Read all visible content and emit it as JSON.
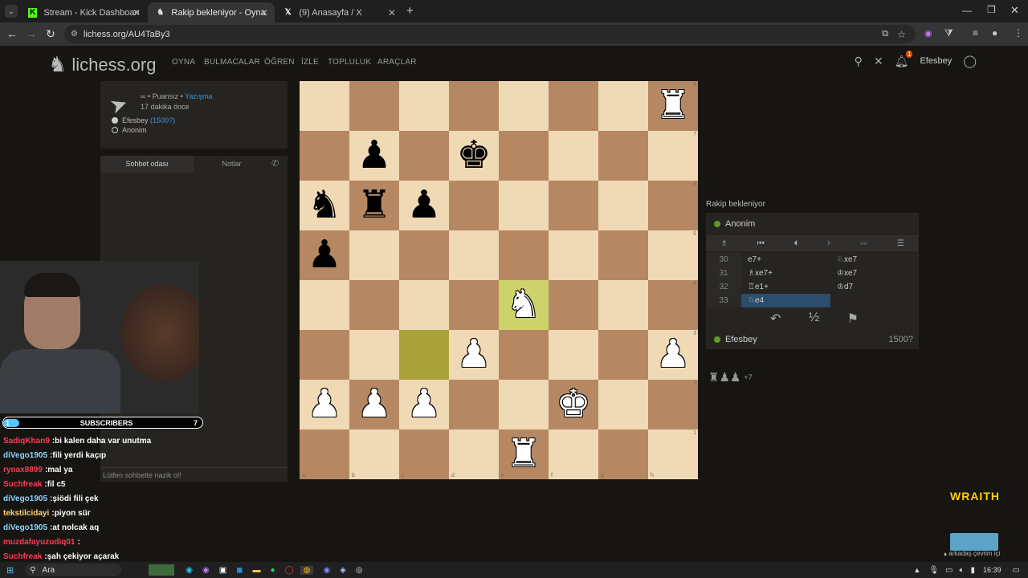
{
  "browser": {
    "tabs": [
      {
        "title": "Stream - Kick Dashboard",
        "icon": "kick-icon"
      },
      {
        "title": "Rakip bekleniyor - Oyna Anon…",
        "icon": "lichess-icon"
      },
      {
        "title": "(9) Anasayfa / X",
        "icon": "x-icon"
      }
    ],
    "url": "lichess.org/AU4TaBy3"
  },
  "site": {
    "logo_text": "lichess.org",
    "nav": [
      "OYNA",
      "BULMACALAR",
      "ÖĞREN",
      "İZLE",
      "TOPLULUK",
      "ARAÇLAR"
    ],
    "username": "Efesbey",
    "notif_count": "1"
  },
  "game_info": {
    "line1_prefix": "∞ • Puansız •",
    "line1_link": "Yazışma",
    "time_ago": "17 dakika önce",
    "player_white": "Efesbey",
    "player_white_rating": "(1500?)",
    "player_black": "Anonim"
  },
  "chat": {
    "tab_room": "Sohbet odası",
    "tab_notes": "Notlar",
    "placeholder": "Lütfen sohbette nazik ol!"
  },
  "board": {
    "rank_labels": [
      "8",
      "7",
      "6",
      "5",
      "4",
      "3",
      "2",
      "1"
    ],
    "file_labels": [
      "a",
      "b",
      "c",
      "d",
      "e",
      "f",
      "g",
      "h"
    ],
    "pieces": [
      {
        "sq": "h8",
        "g": "♜",
        "color": "w",
        "name": "white-rook"
      },
      {
        "sq": "b7",
        "g": "♟",
        "color": "b",
        "name": "black-pawn"
      },
      {
        "sq": "d7",
        "g": "♚",
        "color": "b",
        "name": "black-king"
      },
      {
        "sq": "a6",
        "g": "♞",
        "color": "b",
        "name": "black-knight"
      },
      {
        "sq": "b6",
        "g": "♜",
        "color": "b",
        "name": "black-rook"
      },
      {
        "sq": "c6",
        "g": "♟",
        "color": "b",
        "name": "black-pawn"
      },
      {
        "sq": "a5",
        "g": "♟",
        "color": "b",
        "name": "black-pawn"
      },
      {
        "sq": "e4",
        "g": "♞",
        "color": "w",
        "name": "white-knight"
      },
      {
        "sq": "d3",
        "g": "♟",
        "color": "w",
        "name": "white-pawn"
      },
      {
        "sq": "h3",
        "g": "♟",
        "color": "w",
        "name": "white-pawn"
      },
      {
        "sq": "a2",
        "g": "♟",
        "color": "w",
        "name": "white-pawn"
      },
      {
        "sq": "b2",
        "g": "♟",
        "color": "w",
        "name": "white-pawn"
      },
      {
        "sq": "c2",
        "g": "♟",
        "color": "w",
        "name": "white-pawn"
      },
      {
        "sq": "f2",
        "g": "♚",
        "color": "w",
        "name": "white-king"
      },
      {
        "sq": "e1",
        "g": "♜",
        "color": "w",
        "name": "white-rook"
      }
    ],
    "highlight_last_move_from": "c3",
    "highlight_last_move_to": "e4",
    "light_color": "#f0d9b5",
    "dark_color": "#b58863",
    "highlight_color": "#aaa23a",
    "highlight_to_color": "#cdd26a"
  },
  "right_panel": {
    "status": "Rakip bekleniyor",
    "opponent": "Anonim",
    "me": "Efesbey",
    "me_rating": "1500?",
    "moves": [
      {
        "n": "30",
        "w": "e7+",
        "b": "♘xe7"
      },
      {
        "n": "31",
        "w": "♗xe7+",
        "b": "♔xe7"
      },
      {
        "n": "32",
        "w": "♖e1+",
        "b": "♔d7"
      },
      {
        "n": "33",
        "w": "♘e4",
        "b": ""
      }
    ],
    "material_diff": "+7"
  },
  "stream": {
    "sub_left": "1",
    "sub_label": "SUBSCRIBERS",
    "sub_count": "7",
    "brand": "WRAITH",
    "messages": [
      {
        "user": "SadiqKhan9",
        "text": "bi kalen daha var unutma",
        "color": "#ff3b55"
      },
      {
        "user": "diVego1905",
        "text": "fili yerdi kaçıp",
        "color": "#8fd3ff"
      },
      {
        "user": "rynax8899",
        "text": "mal ya",
        "color": "#ff3b55"
      },
      {
        "user": "Suchfreak",
        "text": "fil c5",
        "color": "#ff3b55"
      },
      {
        "user": "diVego1905",
        "text": "şiödi fili çek",
        "color": "#8fd3ff"
      },
      {
        "user": "tekstilcidayi",
        "text": "piyon sür",
        "color": "#ffd56b"
      },
      {
        "user": "diVego1905",
        "text": "at nolcak aq",
        "color": "#8fd3ff"
      },
      {
        "user": "muzdafayuzudiq01",
        "text": "",
        "color": "#ff3b55"
      },
      {
        "user": "Suchfreak",
        "text": "şah çekiyor açarak",
        "color": "#ff3b55"
      }
    ],
    "friends_online": "arkadaş çevrim içi"
  },
  "taskbar": {
    "search": "Ara",
    "time": "16:39"
  }
}
